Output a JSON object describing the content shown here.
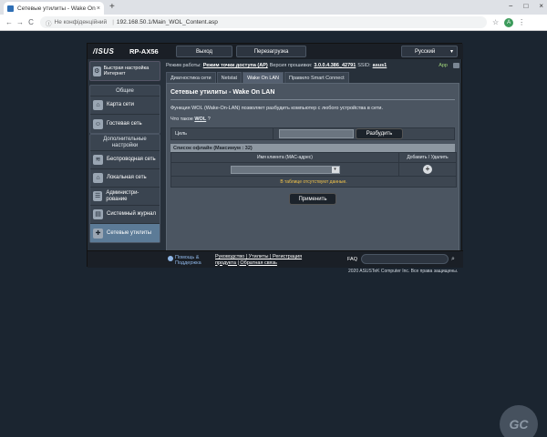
{
  "browser": {
    "tab_title": "Сетевые утилиты - Wake On LAN",
    "tab_close": "×",
    "new_tab": "+",
    "window_controls": [
      "−",
      "□",
      "×"
    ],
    "nav": {
      "back": "←",
      "forward": "→",
      "reload": "C"
    },
    "security_label": "Не конфіденційний",
    "url": "192.168.50.1/Main_WOL_Content.asp",
    "avatar_letter": "A"
  },
  "header": {
    "logo": "/ISUS",
    "model": "RP-AX56",
    "logout_label": "Выход",
    "reboot_label": "Перезагрузка",
    "language": "Русский"
  },
  "sidebar": {
    "quick_setup": "Быстрая настройка Интернет",
    "general_heading": "Общие",
    "general_items": [
      {
        "label": "Карта сети",
        "icon": "network-map-icon"
      },
      {
        "label": "Гостевая сеть",
        "icon": "guest-network-icon"
      }
    ],
    "advanced_heading": "Дополнительные настройки",
    "advanced_items": [
      {
        "label": "Беспроводная сеть",
        "icon": "wifi-icon"
      },
      {
        "label": "Локальная сеть",
        "icon": "lan-icon"
      },
      {
        "label": "Администри-рование",
        "icon": "admin-icon"
      },
      {
        "label": "Системный журнал",
        "icon": "log-icon"
      },
      {
        "label": "Сетевые утилиты",
        "icon": "tools-icon"
      }
    ]
  },
  "status": {
    "mode_label": "Режим работы:",
    "mode_value": "Режим точки доступа (AP)",
    "firmware_label": "Версия прошивки:",
    "firmware_value": "3.0.0.4.386_42791",
    "ssid_label": "SSID:",
    "ssid_value": "asus1",
    "app_label": "App"
  },
  "tabs": [
    {
      "label": "Диагностика сети",
      "active": false
    },
    {
      "label": "Netstat",
      "active": false
    },
    {
      "label": "Wake On LAN",
      "active": true
    },
    {
      "label": "Правило Smart Connect",
      "active": false
    }
  ],
  "panel": {
    "title": "Сетевые утилиты - Wake On LAN",
    "description": "Функция WOL (Wake-On-LAN) позволяет разбудить компьютер с любого устройства в сети.",
    "what_is": "Что такое",
    "what_is_link": "WOL",
    "what_is_suffix": "?",
    "target_label": "Цель",
    "wake_button": "Разбудить",
    "list_heading": "Список офлайн (Максимум : 32)",
    "col_client": "Имя клиента (MAC-адрес)",
    "col_add_remove": "Добавить / Удалить",
    "empty_message": "В таблице отсутствуют данные.",
    "apply_button": "Применить"
  },
  "footer": {
    "help_line1": "Помощь &",
    "help_line2": "Поддержка",
    "links_line1": "Руководство | Утилиты | Регистрация",
    "links_line2": "продукта | Обратная связь",
    "faq": "FAQ"
  },
  "copyright": "2020 ASUSTeK Computer Inc. Все права защищены."
}
